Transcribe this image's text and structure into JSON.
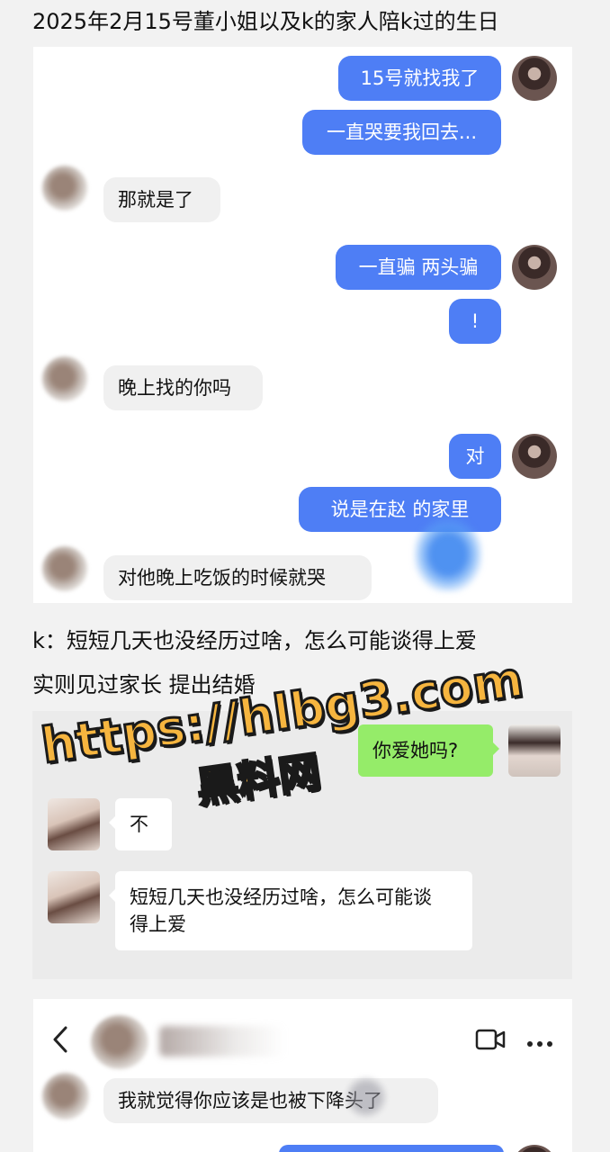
{
  "caption_top": "2025年2月15号董小姐以及k的家人陪k过的生日",
  "chat1": {
    "messages": [
      {
        "side": "out",
        "text": "15号就找我了"
      },
      {
        "side": "out",
        "text": "一直哭要我回去..."
      },
      {
        "side": "in",
        "text": "那就是了"
      },
      {
        "side": "out",
        "text": "一直骗 两头骗"
      },
      {
        "side": "out",
        "text": "!"
      },
      {
        "side": "in",
        "text": "晚上找的你吗"
      },
      {
        "side": "out",
        "text": "对"
      },
      {
        "side": "out",
        "text": "说是在赵      的家里"
      },
      {
        "side": "in",
        "text": "对他晚上吃饭的时候就哭"
      }
    ]
  },
  "caption_mid": "k：短短几天也没经历过啥，怎么可能谈得上爱",
  "caption_mid2": "实则见过家长 提出结婚",
  "chat2": {
    "messages": [
      {
        "side": "out",
        "text": "你爱她吗?"
      },
      {
        "side": "in",
        "text": "不"
      },
      {
        "side": "in",
        "text": "短短几天也没经历过啥，怎么可能谈得上爱"
      }
    ]
  },
  "watermark": {
    "line1": "https://hlbg3.com",
    "line2": "黑料网"
  },
  "chat3": {
    "message": "我就觉得你应该是也被下降头了"
  },
  "icons": {
    "back": "chevron-left-icon",
    "video": "video-camera-icon",
    "more": "more-dots-icon"
  },
  "colors": {
    "bubble_out": "#4e7ef5",
    "bubble_in": "#f0f0f0",
    "wechat_green": "#95ec69",
    "watermark_fill": "#f6b53f"
  }
}
